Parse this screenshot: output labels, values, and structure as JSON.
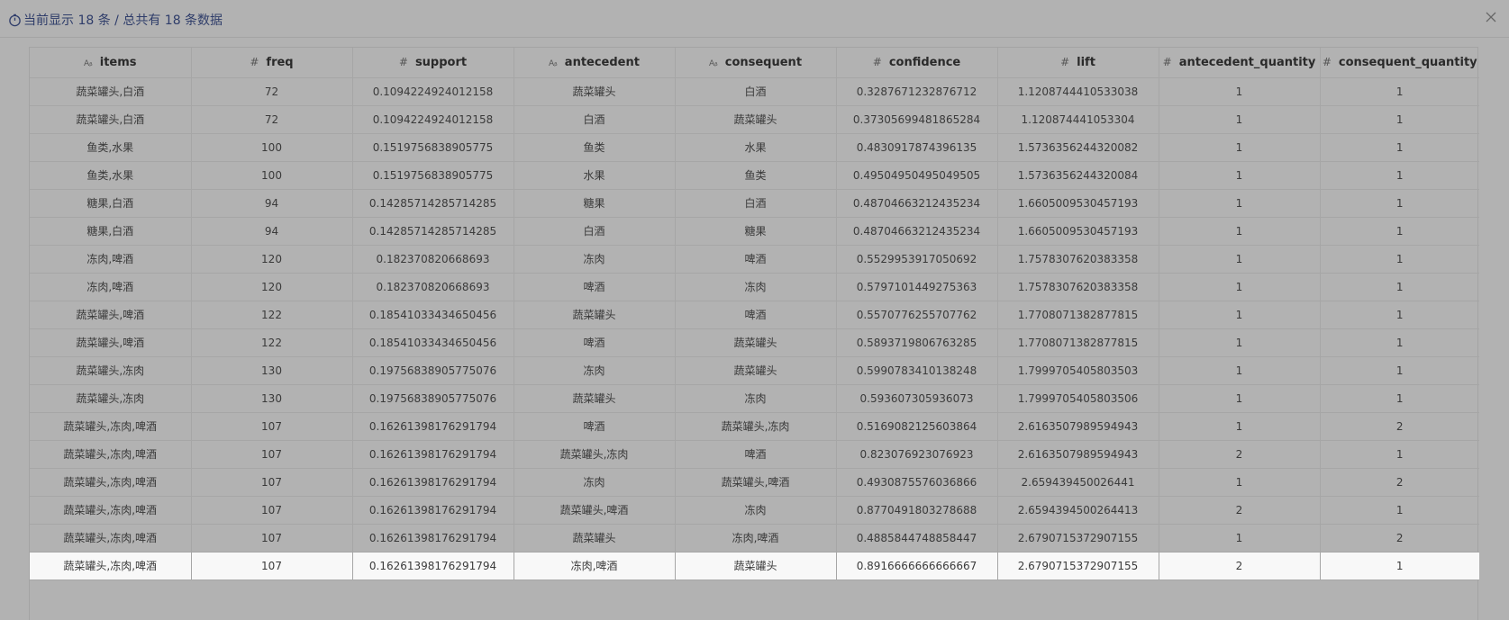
{
  "header": {
    "title": "当前显示 18 条 / 总共有 18 条数据",
    "clock_icon": "clock-icon",
    "close_icon": "close-icon"
  },
  "table": {
    "columns": [
      {
        "type": "Aᵦ",
        "type_icon": "text-type-icon",
        "label": "items"
      },
      {
        "type": "#",
        "type_icon": "number-type-icon",
        "label": "freq"
      },
      {
        "type": "#",
        "type_icon": "number-type-icon",
        "label": "support"
      },
      {
        "type": "Aᵦ",
        "type_icon": "text-type-icon",
        "label": "antecedent"
      },
      {
        "type": "Aᵦ",
        "type_icon": "text-type-icon",
        "label": "consequent"
      },
      {
        "type": "#",
        "type_icon": "number-type-icon",
        "label": "confidence"
      },
      {
        "type": "#",
        "type_icon": "number-type-icon",
        "label": "lift"
      },
      {
        "type": "#",
        "type_icon": "number-type-icon",
        "label": "antecedent_quantity"
      },
      {
        "type": "#",
        "type_icon": "number-type-icon",
        "label": "consequent_quantity"
      }
    ],
    "rows": [
      [
        "蔬菜罐头,白酒",
        "72",
        "0.1094224924012158",
        "蔬菜罐头",
        "白酒",
        "0.3287671232876712",
        "1.1208744410533038",
        "1",
        "1"
      ],
      [
        "蔬菜罐头,白酒",
        "72",
        "0.1094224924012158",
        "白酒",
        "蔬菜罐头",
        "0.37305699481865284",
        "1.120874441053304",
        "1",
        "1"
      ],
      [
        "鱼类,水果",
        "100",
        "0.1519756838905775",
        "鱼类",
        "水果",
        "0.4830917874396135",
        "1.5736356244320082",
        "1",
        "1"
      ],
      [
        "鱼类,水果",
        "100",
        "0.1519756838905775",
        "水果",
        "鱼类",
        "0.49504950495049505",
        "1.5736356244320084",
        "1",
        "1"
      ],
      [
        "糖果,白酒",
        "94",
        "0.14285714285714285",
        "糖果",
        "白酒",
        "0.48704663212435234",
        "1.6605009530457193",
        "1",
        "1"
      ],
      [
        "糖果,白酒",
        "94",
        "0.14285714285714285",
        "白酒",
        "糖果",
        "0.48704663212435234",
        "1.6605009530457193",
        "1",
        "1"
      ],
      [
        "冻肉,啤酒",
        "120",
        "0.182370820668693",
        "冻肉",
        "啤酒",
        "0.5529953917050692",
        "1.7578307620383358",
        "1",
        "1"
      ],
      [
        "冻肉,啤酒",
        "120",
        "0.182370820668693",
        "啤酒",
        "冻肉",
        "0.5797101449275363",
        "1.7578307620383358",
        "1",
        "1"
      ],
      [
        "蔬菜罐头,啤酒",
        "122",
        "0.18541033434650456",
        "蔬菜罐头",
        "啤酒",
        "0.5570776255707762",
        "1.7708071382877815",
        "1",
        "1"
      ],
      [
        "蔬菜罐头,啤酒",
        "122",
        "0.18541033434650456",
        "啤酒",
        "蔬菜罐头",
        "0.5893719806763285",
        "1.7708071382877815",
        "1",
        "1"
      ],
      [
        "蔬菜罐头,冻肉",
        "130",
        "0.19756838905775076",
        "冻肉",
        "蔬菜罐头",
        "0.5990783410138248",
        "1.7999705405803503",
        "1",
        "1"
      ],
      [
        "蔬菜罐头,冻肉",
        "130",
        "0.19756838905775076",
        "蔬菜罐头",
        "冻肉",
        "0.593607305936073",
        "1.7999705405803506",
        "1",
        "1"
      ],
      [
        "蔬菜罐头,冻肉,啤酒",
        "107",
        "0.16261398176291794",
        "啤酒",
        "蔬菜罐头,冻肉",
        "0.5169082125603864",
        "2.6163507989594943",
        "1",
        "2"
      ],
      [
        "蔬菜罐头,冻肉,啤酒",
        "107",
        "0.16261398176291794",
        "蔬菜罐头,冻肉",
        "啤酒",
        "0.823076923076923",
        "2.6163507989594943",
        "2",
        "1"
      ],
      [
        "蔬菜罐头,冻肉,啤酒",
        "107",
        "0.16261398176291794",
        "冻肉",
        "蔬菜罐头,啤酒",
        "0.4930875576036866",
        "2.659439450026441",
        "1",
        "2"
      ],
      [
        "蔬菜罐头,冻肉,啤酒",
        "107",
        "0.16261398176291794",
        "蔬菜罐头,啤酒",
        "冻肉",
        "0.8770491803278688",
        "2.6594394500264413",
        "2",
        "1"
      ],
      [
        "蔬菜罐头,冻肉,啤酒",
        "107",
        "0.16261398176291794",
        "蔬菜罐头",
        "冻肉,啤酒",
        "0.4885844748858447",
        "2.6790715372907155",
        "1",
        "2"
      ],
      [
        "蔬菜罐头,冻肉,啤酒",
        "107",
        "0.16261398176291794",
        "冻肉,啤酒",
        "蔬菜罐头",
        "0.8916666666666667",
        "2.6790715372907155",
        "2",
        "1"
      ]
    ],
    "highlighted_row": 17
  }
}
